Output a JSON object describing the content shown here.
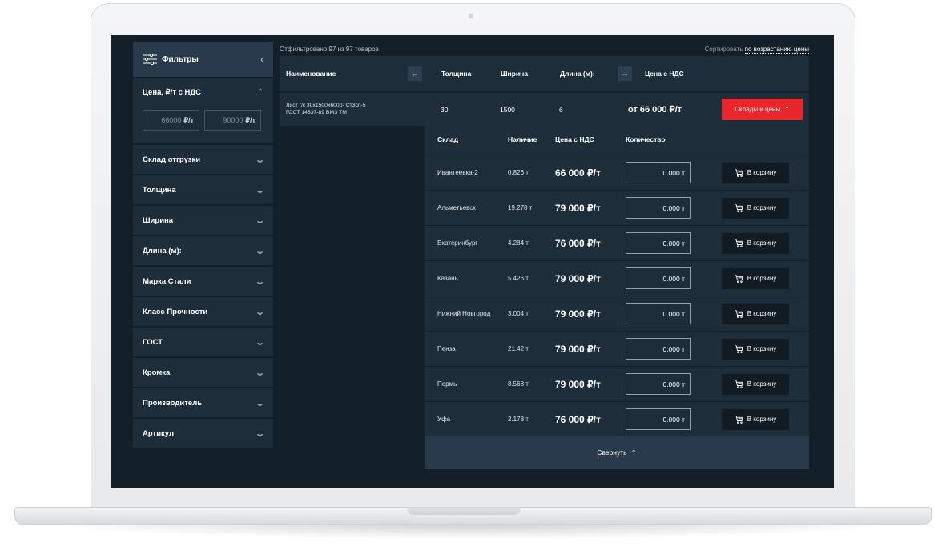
{
  "sidebar": {
    "filters_title": "Фильтры",
    "collapse_icon": "chevron-left",
    "price": {
      "title": "Цена, ₽/т с НДС",
      "min_value": "66000",
      "max_value": "90000",
      "unit": "₽/т"
    },
    "items": [
      {
        "label": "Склад отгрузки"
      },
      {
        "label": "Толщина"
      },
      {
        "label": "Ширина"
      },
      {
        "label": "Длина (м):"
      },
      {
        "label": "Марка Стали"
      },
      {
        "label": "Класс Прочности"
      },
      {
        "label": "ГОСТ"
      },
      {
        "label": "Кромка"
      },
      {
        "label": "Производитель"
      },
      {
        "label": "Артикул"
      }
    ]
  },
  "main": {
    "filtered_text": "Отфильтровано 97 из 97 товаров",
    "sort_prefix": "Сортировать",
    "sort_value": "по возрастанию цены",
    "columns": {
      "name": "Наименование",
      "thickness": "Толщина",
      "width": "Ширина",
      "length": "Длина (м):",
      "price": "Цена с НДС"
    },
    "product": {
      "name_line1": "Лист г/к 30x1500x6000- Ст3сп-5",
      "name_line2": "ГОСТ 14637-89 ВМЗ ТМ",
      "thickness": "30",
      "width": "1500",
      "length": "6",
      "price": "от 66 000 ₽/т",
      "button": "Склады и цены"
    },
    "warehouses": {
      "headers": {
        "warehouse": "Склад",
        "stock": "Наличие",
        "price": "Цена с НДС",
        "qty": "Количество"
      },
      "cart_label": "В корзину",
      "rows": [
        {
          "name": "Ивантеевка-2",
          "stock": "0.826 т",
          "price": "66 000 ₽/т",
          "qty": "0.000 т"
        },
        {
          "name": "Альметьевск",
          "stock": "19.278 т",
          "price": "79 000 ₽/т",
          "qty": "0.000 т"
        },
        {
          "name": "Екатеринбург",
          "stock": "4.284 т",
          "price": "76 000 ₽/т",
          "qty": "0.000 т"
        },
        {
          "name": "Казань",
          "stock": "5.426 т",
          "price": "79 000 ₽/т",
          "qty": "0.000 т"
        },
        {
          "name": "Нижний Новгород",
          "stock": "3.004 т",
          "price": "79 000 ₽/т",
          "qty": "0.000 т"
        },
        {
          "name": "Пенза",
          "stock": "21.42 т",
          "price": "79 000 ₽/т",
          "qty": "0.000 т"
        },
        {
          "name": "Пермь",
          "stock": "8.568 т",
          "price": "79 000 ₽/т",
          "qty": "0.000 т"
        },
        {
          "name": "Уфа",
          "stock": "2.178 т",
          "price": "76 000 ₽/т",
          "qty": "0.000 т"
        }
      ],
      "collapse_label": "Свернуть"
    }
  },
  "colors": {
    "background": "#131f29",
    "panel": "#1d2d3a",
    "panel_light": "#283a4b",
    "accent_red": "#e8262c"
  }
}
